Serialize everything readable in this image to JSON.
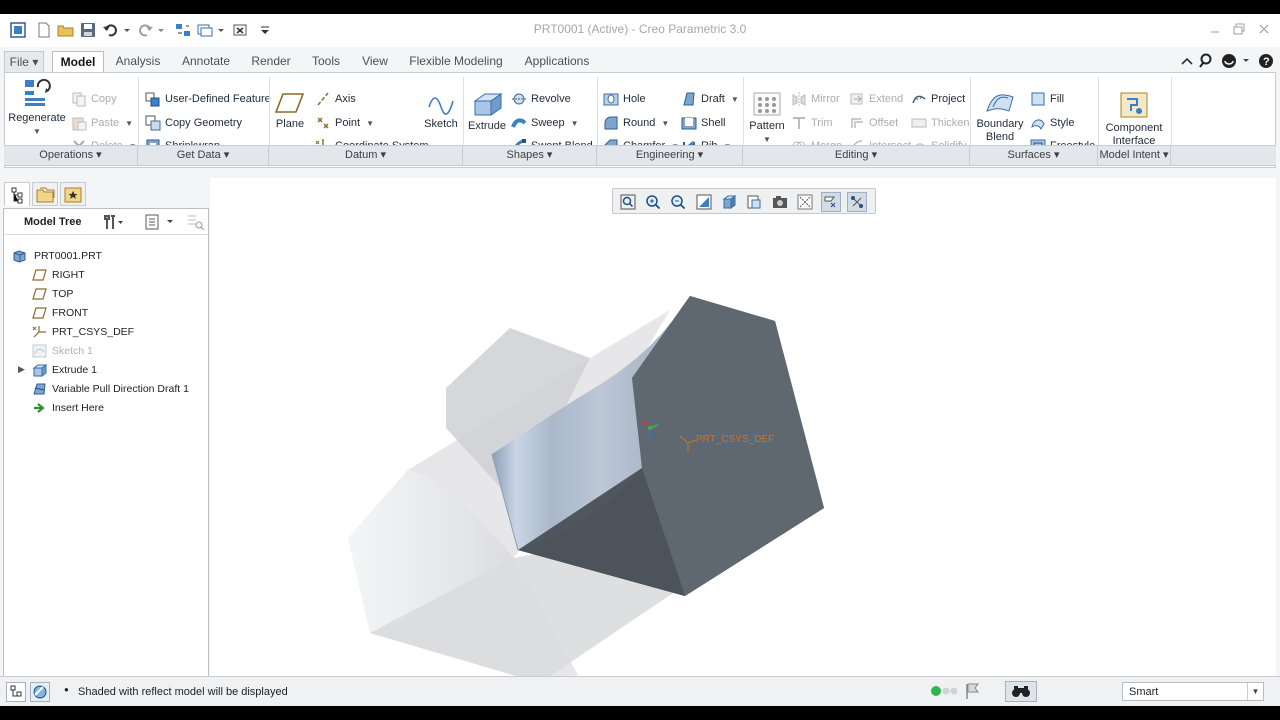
{
  "window": {
    "title": "PRT0001 (Active) - Creo Parametric 3.0"
  },
  "tabs": [
    "File",
    "Model",
    "Analysis",
    "Annotate",
    "Render",
    "Tools",
    "View",
    "Flexible Modeling",
    "Applications"
  ],
  "active_tab": "Model",
  "ribbon": {
    "operations": {
      "regenerate": "Regenerate",
      "copy": "Copy",
      "paste": "Paste",
      "delete": "Delete"
    },
    "get_data": {
      "udf": "User-Defined Feature",
      "copy_geometry": "Copy Geometry",
      "shrinkwrap": "Shrinkwrap"
    },
    "datum": {
      "plane": "Plane",
      "axis": "Axis",
      "point": "Point",
      "csys": "Coordinate System",
      "sketch": "Sketch"
    },
    "shapes": {
      "extrude": "Extrude",
      "revolve": "Revolve",
      "sweep": "Sweep",
      "swept_blend": "Swept Blend"
    },
    "engineering": {
      "hole": "Hole",
      "round": "Round",
      "chamfer": "Chamfer",
      "draft": "Draft",
      "shell": "Shell",
      "rib": "Rib"
    },
    "editing": {
      "pattern": "Pattern",
      "mirror": "Mirror",
      "trim": "Trim",
      "merge": "Merge",
      "extend": "Extend",
      "offset": "Offset",
      "intersect": "Intersect",
      "project": "Project",
      "thicken": "Thicken",
      "solidify": "Solidify"
    },
    "surfaces": {
      "boundary_blend_1": "Boundary",
      "boundary_blend_2": "Blend",
      "fill": "Fill",
      "style": "Style",
      "freestyle": "Freestyle"
    },
    "model_intent": {
      "component_interface_1": "Component",
      "component_interface_2": "Interface"
    }
  },
  "groups": [
    "Operations",
    "Get Data",
    "Datum",
    "Shapes",
    "Engineering",
    "Editing",
    "Surfaces",
    "Model Intent"
  ],
  "model_tree": {
    "header": "Model Tree",
    "items": [
      "PRT0001.PRT",
      "RIGHT",
      "TOP",
      "FRONT",
      "PRT_CSYS_DEF",
      "Sketch 1",
      "Extrude 1",
      "Variable Pull Direction Draft 1",
      "Insert Here"
    ]
  },
  "viewport": {
    "csys_label": "PRT_CSYS_DEF"
  },
  "status": {
    "message": "Shaded with reflect model will be displayed",
    "filter": "Smart"
  },
  "colors": {
    "accent": "#2f78c4",
    "green_status": "#2fb84a"
  }
}
